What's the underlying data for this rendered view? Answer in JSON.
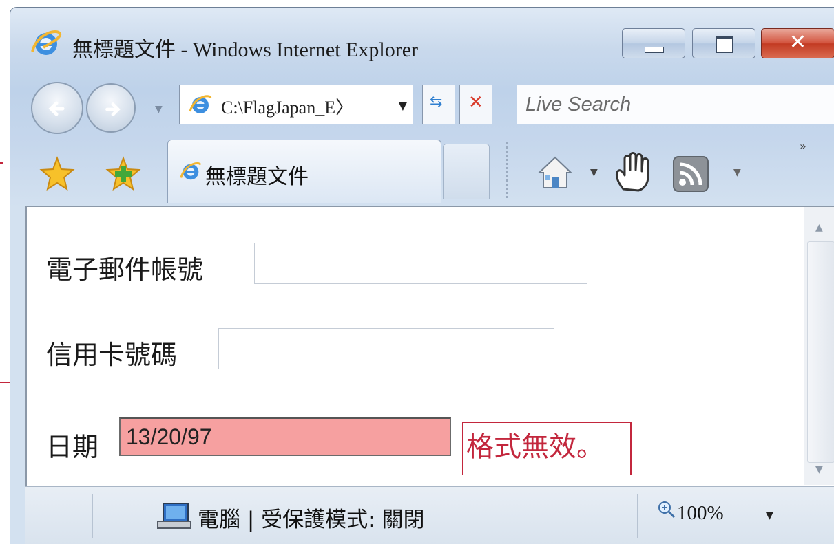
{
  "window": {
    "title": "無標題文件 - Windows Internet Explorer",
    "close_glyph": "✕"
  },
  "nav": {
    "address": "C:\\FlagJapan_E\\",
    "address_display": "C:\\FlagJapan_E〉",
    "search_placeholder": "Live Search"
  },
  "tabs": [
    {
      "label": "無標題文件"
    }
  ],
  "form": {
    "email_label": "電子郵件帳號",
    "email_value": "",
    "card_label": "信用卡號碼",
    "card_value": "",
    "date_label": "日期",
    "date_value": "13/20/97",
    "date_error": "格式無效。"
  },
  "status": {
    "zone_text": "電腦 | 受保護模式: 關閉",
    "zoom": "100%"
  },
  "colors": {
    "error": "#c3273d",
    "invalid_field_bg": "#f6a0a0",
    "close_button": "#c23a22"
  }
}
